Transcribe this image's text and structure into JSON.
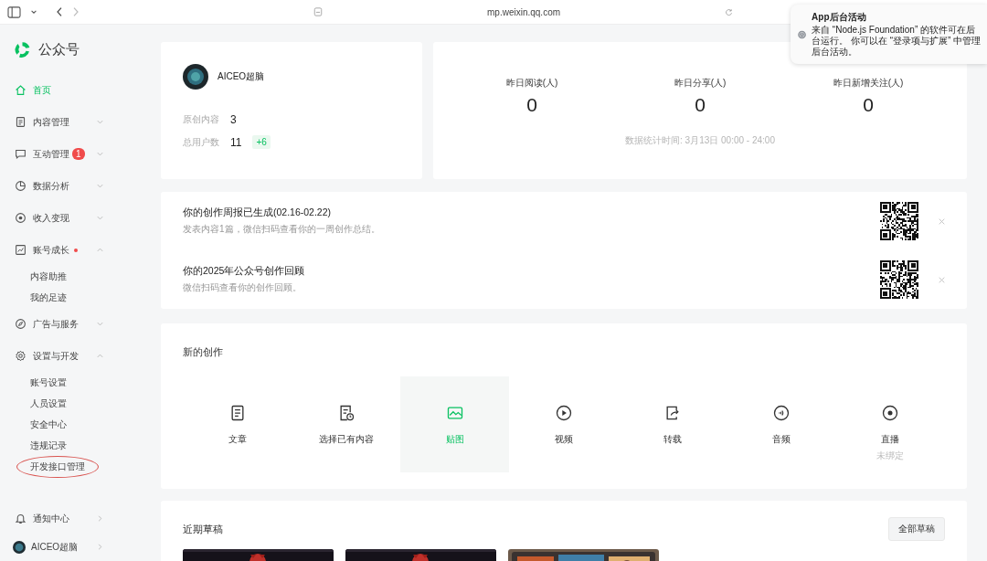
{
  "browser": {
    "url": "mp.weixin.qq.com"
  },
  "notification": {
    "title": "App后台活动",
    "body": "来自 “Node.js Foundation” 的软件可在后台运行。 你可以在 “登录项与扩展” 中管理后台活动。"
  },
  "sidebar": {
    "logo": "公众号",
    "items": [
      {
        "label": "首页",
        "selected": true,
        "dot": false
      },
      {
        "label": "内容管理",
        "selected": false,
        "expanded": false,
        "dot": false
      },
      {
        "label": "互动管理",
        "selected": false,
        "expanded": false,
        "dot": false,
        "badge": "1"
      },
      {
        "label": "数据分析",
        "selected": false,
        "expanded": false,
        "dot": false
      },
      {
        "label": "收入变现",
        "selected": false,
        "expanded": false,
        "dot": false
      },
      {
        "label": "账号成长",
        "selected": false,
        "expanded": true,
        "dot": true,
        "children": [
          {
            "label": "内容助推",
            "circled": false
          },
          {
            "label": "我的足迹",
            "circled": false
          }
        ]
      },
      {
        "label": "广告与服务",
        "selected": false,
        "expanded": false,
        "dot": false
      },
      {
        "label": "设置与开发",
        "selected": false,
        "expanded": true,
        "dot": false,
        "children": [
          {
            "label": "账号设置",
            "circled": false
          },
          {
            "label": "人员设置",
            "circled": false
          },
          {
            "label": "安全中心",
            "circled": false
          },
          {
            "label": "违规记录",
            "circled": false
          },
          {
            "label": "开发接口管理",
            "circled": true
          }
        ]
      }
    ],
    "footer": [
      {
        "label": "通知中心"
      },
      {
        "label": "AICEO超脑"
      }
    ]
  },
  "account": {
    "name": "AICEO超脑",
    "stats": [
      {
        "label": "原创内容",
        "value": "3"
      },
      {
        "label": "总用户数",
        "value": "11",
        "delta": "+6"
      }
    ]
  },
  "yesterday": {
    "metrics": [
      {
        "label": "昨日阅读(人)",
        "value": "0"
      },
      {
        "label": "昨日分享(人)",
        "value": "0"
      },
      {
        "label": "昨日新增关注(人)",
        "value": "0"
      }
    ],
    "note": "数据统计时间: 3月13日 00:00 - 24:00"
  },
  "notices": [
    {
      "title": "你的创作周报已生成(02.16-02.22)",
      "desc": "发表内容1篇，微信扫码查看你的一周创作总结。"
    },
    {
      "title": "你的2025年公众号创作回顾",
      "desc": "微信扫码查看你的创作回顾。"
    }
  ],
  "creation": {
    "title": "新的创作",
    "items": [
      {
        "label": "文章",
        "selected": false
      },
      {
        "label": "选择已有内容",
        "selected": false
      },
      {
        "label": "贴图",
        "selected": true
      },
      {
        "label": "视频",
        "selected": false
      },
      {
        "label": "转载",
        "selected": false
      },
      {
        "label": "音频",
        "selected": false
      },
      {
        "label": "直播",
        "selected": false,
        "sub": "未绑定"
      }
    ]
  },
  "drafts": {
    "title": "近期草稿",
    "button": "全部草稿"
  }
}
